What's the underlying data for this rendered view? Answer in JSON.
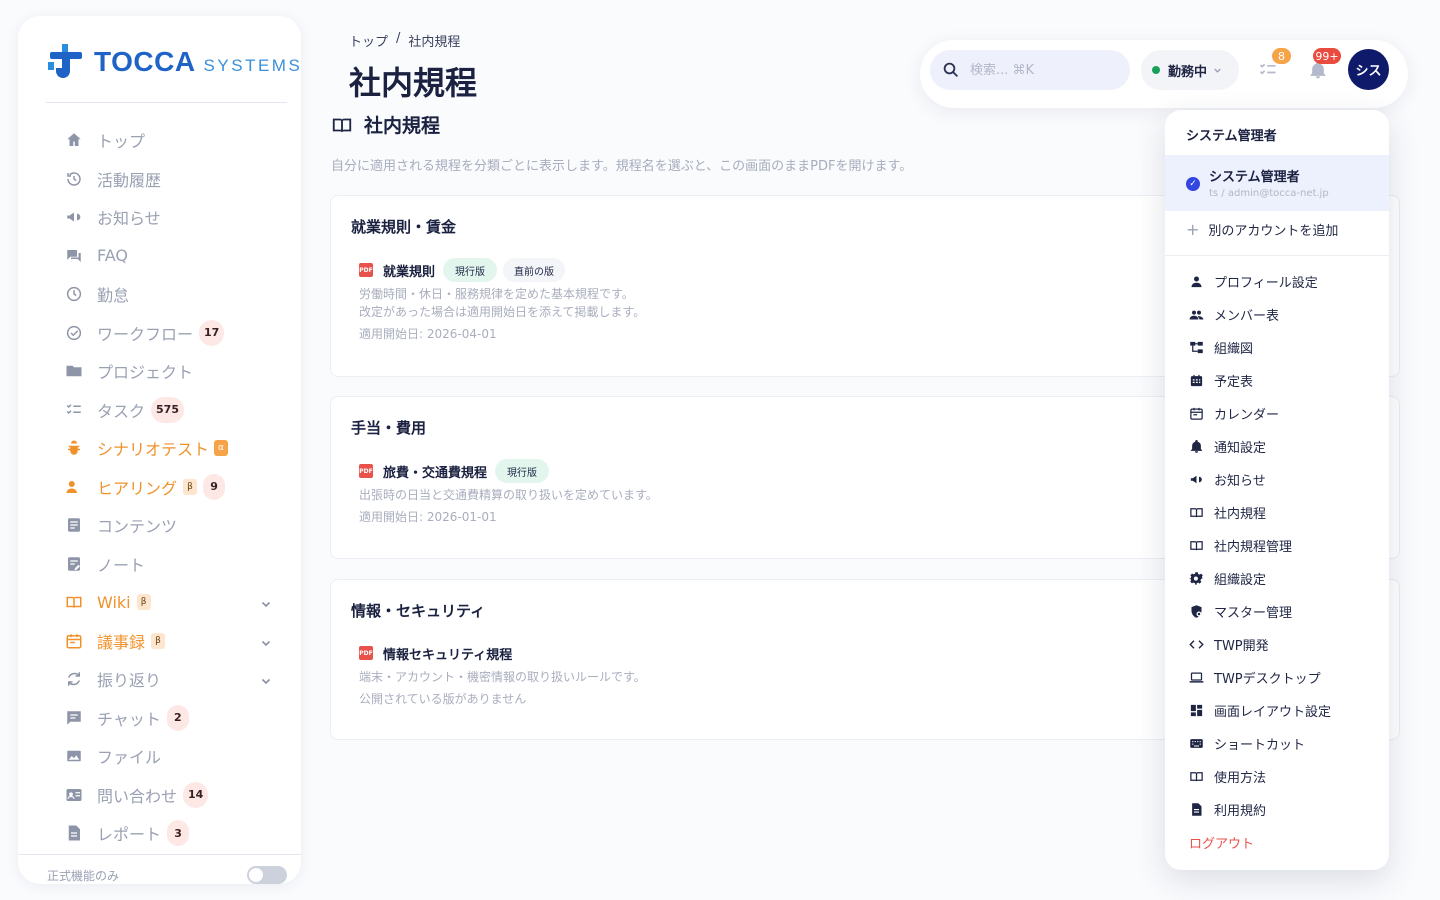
{
  "brand": {
    "name": "TOCCA",
    "suffix": "SYSTEMS"
  },
  "sidebar": {
    "items": [
      {
        "label": "トップ",
        "icon": "home-icon",
        "style": "normal"
      },
      {
        "label": "活動履歴",
        "icon": "history-icon",
        "style": "normal"
      },
      {
        "label": "お知らせ",
        "icon": "megaphone-icon",
        "style": "normal"
      },
      {
        "label": "FAQ",
        "icon": "chat-bubbles-icon",
        "style": "normal"
      },
      {
        "label": "勤怠",
        "icon": "clock-icon",
        "style": "normal"
      },
      {
        "label": "ワークフロー",
        "icon": "check-circle-icon",
        "style": "normal",
        "count": "17"
      },
      {
        "label": "プロジェクト",
        "icon": "folder-icon",
        "style": "normal"
      },
      {
        "label": "タスク",
        "icon": "checklist-icon",
        "style": "normal",
        "count": "575"
      },
      {
        "label": "シナリオテスト",
        "icon": "bug-icon",
        "style": "orange",
        "badge": "α"
      },
      {
        "label": "ヒアリング",
        "icon": "interview-icon",
        "style": "orange",
        "badge": "β",
        "count": "9"
      },
      {
        "label": "コンテンツ",
        "icon": "article-icon",
        "style": "normal"
      },
      {
        "label": "ノート",
        "icon": "note-icon",
        "style": "normal"
      },
      {
        "label": "Wiki",
        "icon": "book-open-icon",
        "style": "orange",
        "badge": "β",
        "expandable": true
      },
      {
        "label": "議事録",
        "icon": "calendar-icon",
        "style": "orange",
        "badge": "β",
        "expandable": true
      },
      {
        "label": "振り返り",
        "icon": "refresh-icon",
        "style": "normal",
        "expandable": true
      },
      {
        "label": "チャット",
        "icon": "chat-icon",
        "style": "normal",
        "count": "2"
      },
      {
        "label": "ファイル",
        "icon": "images-icon",
        "style": "normal"
      },
      {
        "label": "問い合わせ",
        "icon": "contact-card-icon",
        "style": "normal",
        "count": "14"
      },
      {
        "label": "レポート",
        "icon": "report-icon",
        "style": "normal",
        "count": "3"
      }
    ],
    "footer_label": "正式機能のみ"
  },
  "header": {
    "breadcrumb": {
      "home": "トップ",
      "separator": "/",
      "current": "社内規程"
    },
    "title": "社内規程",
    "search_placeholder": "検索... ⌘K",
    "status_label": "勤務中",
    "status_color": "#18a05a",
    "tasks_badge": "8",
    "notifications_badge": "99+",
    "avatar_text": "シス"
  },
  "main": {
    "section_title": "社内規程",
    "description": "自分に適用される規程を分類ごとに表示します。規程名を選ぶと、この画面のままPDFを開けます。",
    "categories": [
      {
        "title": "就業規則・賃金",
        "docs": [
          {
            "name": "就業規則",
            "tag_current": "現行版",
            "tag_prev": "直前の版",
            "desc1": "労働時間・休日・服務規律を定めた基本規程です。",
            "desc2": "改定があった場合は適用開始日を添えて掲載します。",
            "date": "適用開始日: 2026-04-01"
          }
        ]
      },
      {
        "title": "手当・費用",
        "docs": [
          {
            "name": "旅費・交通費規程",
            "tag_current": "現行版",
            "desc1": "出張時の日当と交通費精算の取り扱いを定めています。",
            "date": "適用開始日: 2026-01-01"
          }
        ]
      },
      {
        "title": "情報・セキュリティ",
        "docs": [
          {
            "name": "情報セキュリティ規程",
            "desc1": "端末・アカウント・機密情報の取り扱いルールです。",
            "date": "公開されている版がありません"
          }
        ]
      }
    ]
  },
  "account_menu": {
    "heading": "システム管理者",
    "current_account": {
      "name": "システム管理者",
      "sub": "ts / admin@tocca-net.jp"
    },
    "add_account": "別のアカウントを追加",
    "items": [
      {
        "label": "プロフィール設定",
        "icon": "person-icon"
      },
      {
        "label": "メンバー表",
        "icon": "people-icon"
      },
      {
        "label": "組織図",
        "icon": "org-chart-icon"
      },
      {
        "label": "予定表",
        "icon": "schedule-icon"
      },
      {
        "label": "カレンダー",
        "icon": "calendar-icon"
      },
      {
        "label": "通知設定",
        "icon": "bell-icon"
      },
      {
        "label": "お知らせ",
        "icon": "megaphone-icon"
      },
      {
        "label": "社内規程",
        "icon": "book-icon"
      },
      {
        "label": "社内規程管理",
        "icon": "book-icon"
      },
      {
        "label": "組織設定",
        "icon": "gear-icon"
      },
      {
        "label": "マスター管理",
        "icon": "shield-gear-icon"
      },
      {
        "label": "TWP開発",
        "icon": "code-icon"
      },
      {
        "label": "TWPデスクトップ",
        "icon": "laptop-icon"
      },
      {
        "label": "画面レイアウト設定",
        "icon": "dashboard-icon"
      },
      {
        "label": "ショートカット",
        "icon": "keyboard-icon"
      },
      {
        "label": "使用方法",
        "icon": "book-icon"
      },
      {
        "label": "利用規約",
        "icon": "document-icon"
      }
    ],
    "logout": "ログアウト"
  }
}
